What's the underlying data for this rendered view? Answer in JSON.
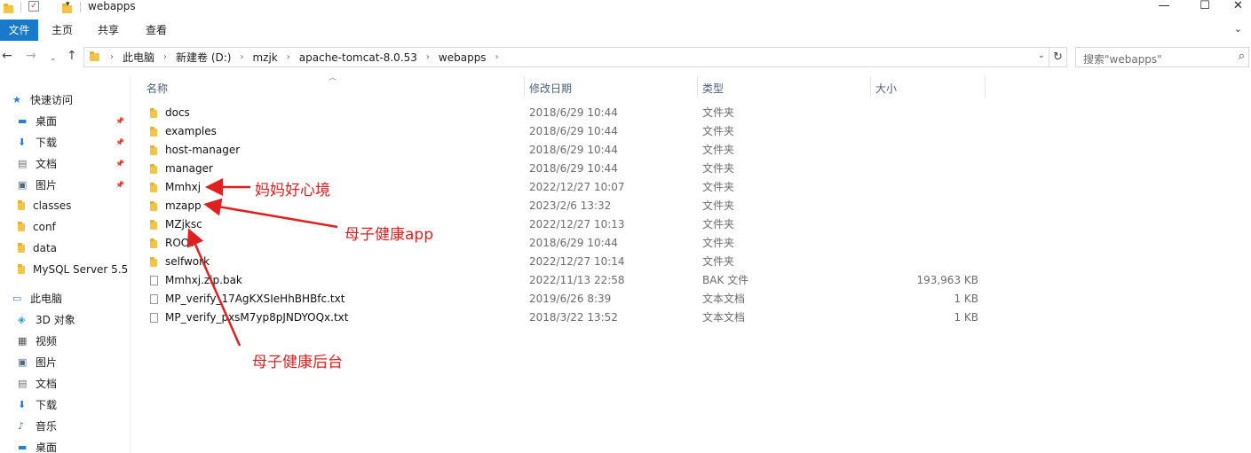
{
  "window": {
    "title": "webapps",
    "minimize_glyph": "—",
    "maximize_glyph": "☐",
    "close_glyph": "✕"
  },
  "ribbon": {
    "tabs": [
      "文件",
      "主页",
      "共享",
      "查看"
    ],
    "expand_glyph": "⌄"
  },
  "address": {
    "crumbs": [
      "此电脑",
      "新建卷 (D:)",
      "mzjk",
      "apache-tomcat-8.0.53",
      "webapps"
    ],
    "search_placeholder": "搜索\"webapps\""
  },
  "nav": {
    "items": [
      {
        "label": "快速访问",
        "icon": "star-icon",
        "pinned": false
      },
      {
        "label": "桌面",
        "icon": "desktop-icon",
        "pinned": true
      },
      {
        "label": "下载",
        "icon": "download-icon",
        "pinned": true
      },
      {
        "label": "文档",
        "icon": "document-icon",
        "pinned": true
      },
      {
        "label": "图片",
        "icon": "pictures-icon",
        "pinned": true
      },
      {
        "label": "classes",
        "icon": "folder-icon",
        "pinned": false
      },
      {
        "label": "conf",
        "icon": "folder-icon",
        "pinned": false
      },
      {
        "label": "data",
        "icon": "folder-icon",
        "pinned": false
      },
      {
        "label": "MySQL Server 5.5",
        "icon": "folder-icon",
        "pinned": false
      },
      {
        "label": "此电脑",
        "icon": "computer-icon",
        "pinned": false
      },
      {
        "label": "3D 对象",
        "icon": "3d-objects-icon",
        "pinned": false
      },
      {
        "label": "视频",
        "icon": "video-icon",
        "pinned": false
      },
      {
        "label": "图片",
        "icon": "pictures-icon",
        "pinned": false
      },
      {
        "label": "文档",
        "icon": "document-icon",
        "pinned": false
      },
      {
        "label": "下载",
        "icon": "download-icon",
        "pinned": false
      },
      {
        "label": "音乐",
        "icon": "music-icon",
        "pinned": false
      },
      {
        "label": "桌面",
        "icon": "desktop-icon",
        "pinned": false
      }
    ]
  },
  "columns": {
    "name": "名称",
    "date": "修改日期",
    "type": "类型",
    "size": "大小"
  },
  "files": [
    {
      "name": "docs",
      "date": "2018/6/29 10:44",
      "type": "文件夹",
      "size": "",
      "kind": "folder"
    },
    {
      "name": "examples",
      "date": "2018/6/29 10:44",
      "type": "文件夹",
      "size": "",
      "kind": "folder"
    },
    {
      "name": "host-manager",
      "date": "2018/6/29 10:44",
      "type": "文件夹",
      "size": "",
      "kind": "folder"
    },
    {
      "name": "manager",
      "date": "2018/6/29 10:44",
      "type": "文件夹",
      "size": "",
      "kind": "folder"
    },
    {
      "name": "Mmhxj",
      "date": "2022/12/27 10:07",
      "type": "文件夹",
      "size": "",
      "kind": "folder"
    },
    {
      "name": "mzapp",
      "date": "2023/2/6 13:32",
      "type": "文件夹",
      "size": "",
      "kind": "folder"
    },
    {
      "name": "MZjksc",
      "date": "2022/12/27 10:13",
      "type": "文件夹",
      "size": "",
      "kind": "folder"
    },
    {
      "name": "ROOT",
      "date": "2018/6/29 10:44",
      "type": "文件夹",
      "size": "",
      "kind": "folder"
    },
    {
      "name": "selfwork",
      "date": "2022/12/27 10:14",
      "type": "文件夹",
      "size": "",
      "kind": "folder"
    },
    {
      "name": "Mmhxj.zip.bak",
      "date": "2022/11/13 22:58",
      "type": "BAK 文件",
      "size": "193,963 KB",
      "kind": "file"
    },
    {
      "name": "MP_verify_17AgKXSIeHhBHBfc.txt",
      "date": "2019/6/26 8:39",
      "type": "文本文档",
      "size": "1 KB",
      "kind": "file"
    },
    {
      "name": "MP_verify_pxsM7yp8pJNDYOQx.txt",
      "date": "2018/3/22 13:52",
      "type": "文本文档",
      "size": "1 KB",
      "kind": "file"
    }
  ],
  "annotations": {
    "mmhxj": "妈妈好心境",
    "mzapp": "母子健康app",
    "mzjksc": "母子健康后台",
    "color": "#e02020"
  },
  "colors": {
    "accent": "#1979ca",
    "folder": "#f3c445"
  }
}
